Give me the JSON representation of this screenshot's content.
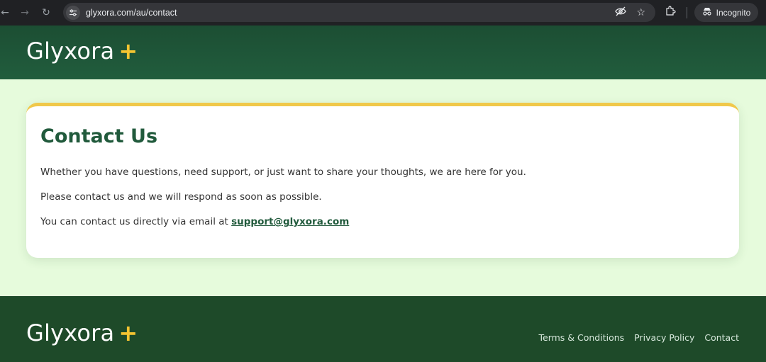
{
  "browser": {
    "url": "glyxora.com/au/contact",
    "incognito_label": "Incognito"
  },
  "header": {
    "logo_text": "Glyxora",
    "logo_mark": "+"
  },
  "card": {
    "title": "Contact Us",
    "p1": "Whether you have questions, need support, or just want to share your thoughts, we are here for you.",
    "p2": "Please contact us and we will respond as soon as possible.",
    "p3_prefix": "You can contact us directly via email at ",
    "email": "support@glyxora.com"
  },
  "footer": {
    "logo_text": "Glyxora",
    "logo_mark": "+",
    "links": [
      "Terms & Conditions",
      "Privacy Policy",
      "Contact"
    ]
  },
  "colors": {
    "header_green": "#1c4e33",
    "footer_green": "#1e4a29",
    "accent_yellow": "#f5c431",
    "page_bg": "#e6fbdc"
  },
  "icons": {
    "back": "arrow-left-icon",
    "forward": "arrow-right-icon",
    "reload": "reload-icon",
    "site_info": "tune-icon",
    "eye_off": "eye-off-icon",
    "star": "star-icon",
    "extensions": "puzzle-icon",
    "incognito": "incognito-icon"
  }
}
